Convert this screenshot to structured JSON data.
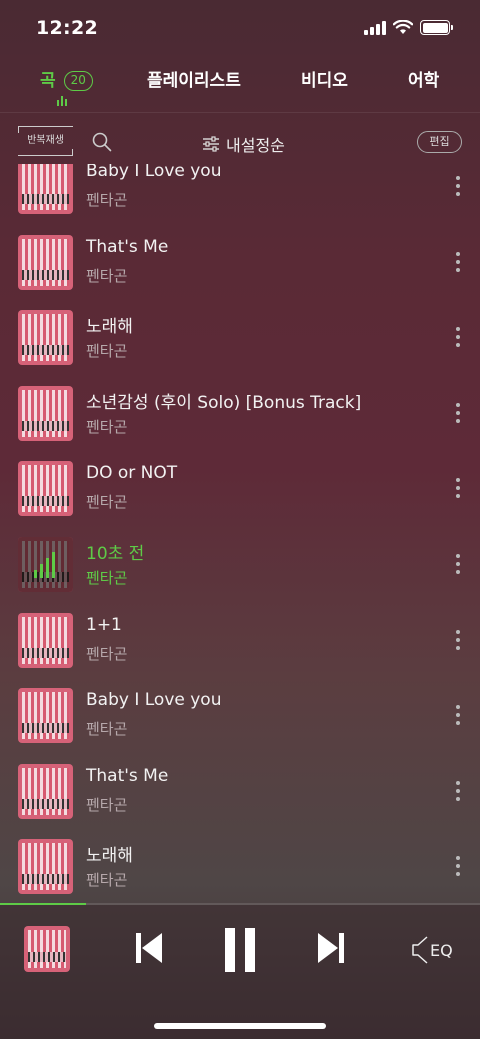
{
  "status": {
    "time": "12:22"
  },
  "tabs": [
    {
      "label": "곡",
      "count": "20",
      "active": true
    },
    {
      "label": "플레이리스트"
    },
    {
      "label": "비디오"
    },
    {
      "label": "어학"
    }
  ],
  "toolbar": {
    "repeat_label": "반복재생",
    "sort_label": "내설정순",
    "edit_label": "편집"
  },
  "songs": [
    {
      "title": "Baby I Love you",
      "artist": "펜타곤"
    },
    {
      "title": "That's Me",
      "artist": "펜타곤"
    },
    {
      "title": "노래해",
      "artist": "펜타곤"
    },
    {
      "title": "소년감성 (후이 Solo) [Bonus Track]",
      "artist": "펜타곤"
    },
    {
      "title": "DO or NOT",
      "artist": "펜타곤"
    },
    {
      "title": "10초 전",
      "artist": "펜타곤",
      "playing": true
    },
    {
      "title": "1+1",
      "artist": "펜타곤"
    },
    {
      "title": "Baby I Love you",
      "artist": "펜타곤"
    },
    {
      "title": "That's Me",
      "artist": "펜타곤"
    },
    {
      "title": "노래해",
      "artist": "펜타곤"
    }
  ],
  "player": {
    "progress": 0.18,
    "eq_label": "EQ",
    "state": "playing"
  },
  "colors": {
    "accent": "#5ecb47"
  },
  "icons": [
    "search-icon",
    "sort-icon",
    "more-icon",
    "prev-icon",
    "pause-icon",
    "next-icon",
    "eq-icon"
  ]
}
